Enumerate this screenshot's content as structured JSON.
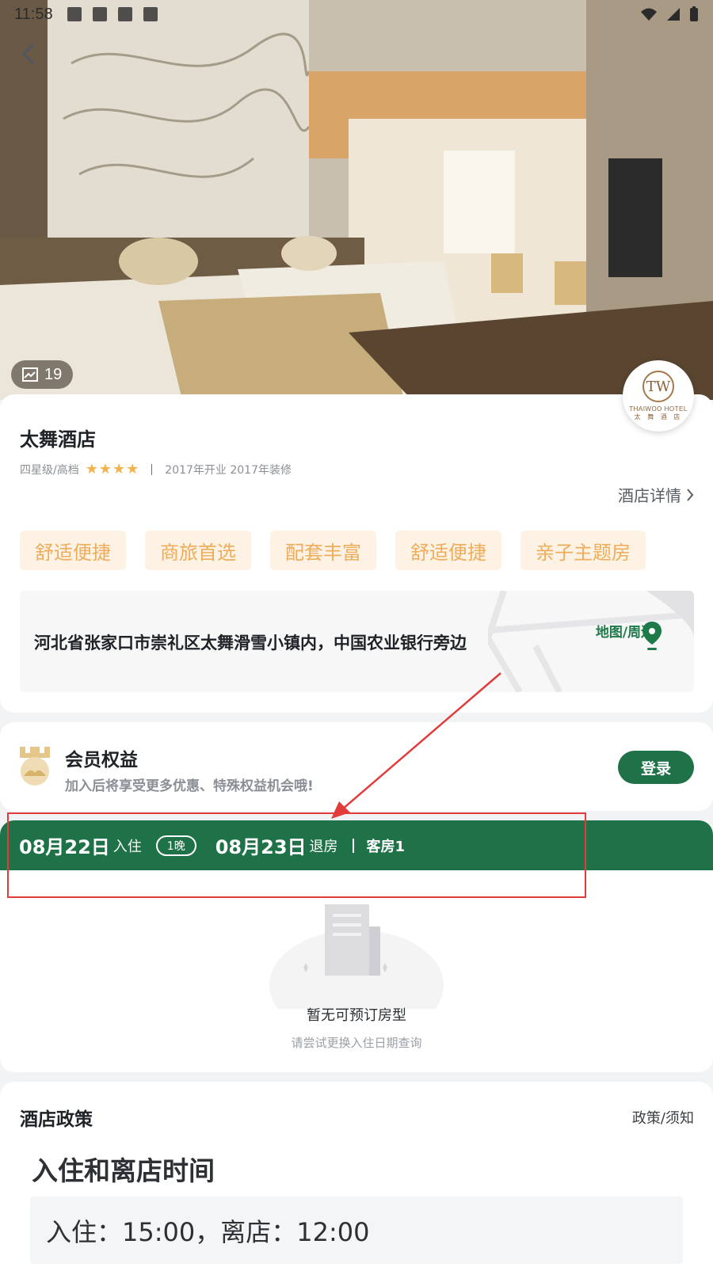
{
  "status_bar": {
    "time": "11:58"
  },
  "hero": {
    "photo_count": "19",
    "logo": {
      "mark": "TW",
      "name_en": "THAIWOO HOTEL",
      "name_cn": "太 舞 酒 店"
    }
  },
  "hotel": {
    "name": "太舞酒店",
    "rating_label": "四星级/高档",
    "stars": 4,
    "opened": "2017年开业 2017年装修",
    "detail_link": "酒店详情",
    "tags": [
      "舒适便捷",
      "商旅首选",
      "配套丰富",
      "舒适便捷",
      "亲子主题房"
    ],
    "address": "河北省张家口市崇礼区太舞滑雪小镇内，中国农业银行旁边",
    "map_link": "地图/周边"
  },
  "member": {
    "title": "会员权益",
    "subtitle": "加入后将享受更多优惠、特殊权益机会哦!",
    "login_label": "登录"
  },
  "booking": {
    "checkin_date": "08月22日",
    "checkin_label": "入住",
    "nights": "1晚",
    "checkout_date": "08月23日",
    "checkout_label": "退房",
    "rooms": "客房1"
  },
  "empty_state": {
    "title": "暂无可预订房型",
    "subtitle": "请尝试更换入住日期查询"
  },
  "policy": {
    "title": "酒店政策",
    "link": "政策/须知",
    "heading": "入住和离店时间",
    "text": "入住：15:00，离店：12:00"
  },
  "colors": {
    "brand_green": "#1f7248",
    "tag_bg": "#fdf2e4",
    "tag_text": "#efac5a",
    "annotation_red": "#e23b3b"
  }
}
